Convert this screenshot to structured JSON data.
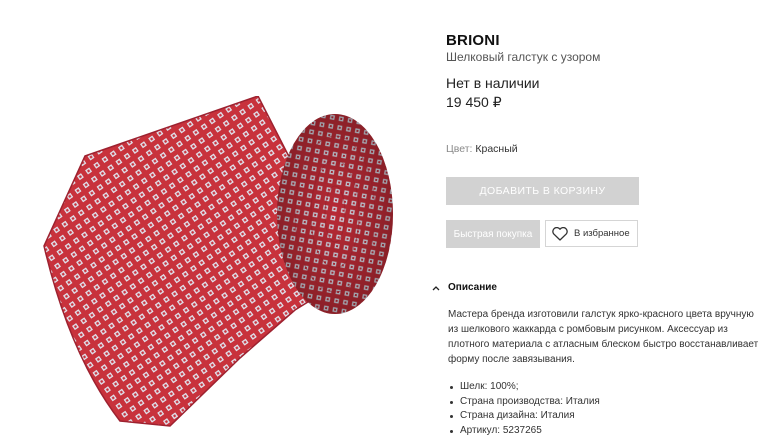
{
  "product": {
    "brand": "BRIONI",
    "name": "Шелковый галстук с узором",
    "availability": "Нет в наличии",
    "price": "19 450 ₽",
    "color_label": "Цвет:",
    "color_value": "Красный",
    "main_color": "#c8323c"
  },
  "actions": {
    "add_to_cart": "ДОБАВИТЬ В КОРЗИНУ",
    "quick_buy": "Быстрая покупка",
    "favorite": "В избранное"
  },
  "description": {
    "title": "Описание",
    "text": "Мастера бренда изготовили галстук ярко-красного цвета вручную из шелкового жаккарда с ромбовым рисунком. Аксессуар из плотного материала с атласным блеском быстро восстанавливает форму после завязывания.",
    "features": [
      "Шелк: 100%;",
      "Страна производства: Италия",
      "Страна дизайна: Италия",
      "Артикул: 5237265"
    ]
  }
}
